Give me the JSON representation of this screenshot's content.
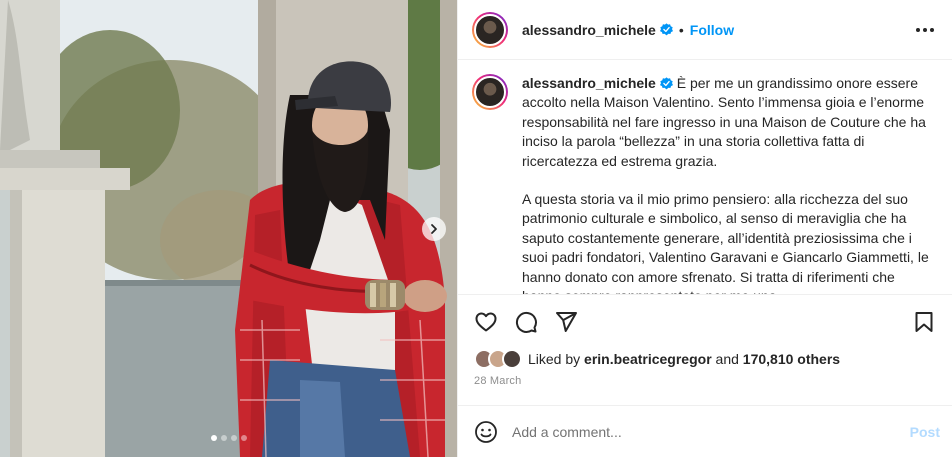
{
  "post": {
    "username": "alessandro_michele",
    "verified": true,
    "follow_label": "Follow",
    "separator": "•",
    "caption_paragraphs": [
      "È per me un grandissimo onore essere accolto nella Maison Valentino. Sento l’immensa gioia e l’enorme responsabilità nel fare ingresso in una Maison de Couture che ha inciso la parola “bellezza” in una storia collettiva fatta di ricercatezza ed estrema grazia.",
      "A questa storia va il mio primo pensiero: alla ricchezza del suo patrimonio culturale e simbolico, al senso di meraviglia che ha saputo costantemente generare, all’identità preziosissima che i suoi padri fondatori, Valentino Garavani e Giancarlo Giammetti, le hanno donato con amore sfrenato. Si tratta di riferimenti che hanno sempre rappresentato per me una"
    ],
    "carousel": {
      "total": 4,
      "current": 1
    }
  },
  "likes": {
    "prefix": "Liked by",
    "liker": "erin.beatricegregor",
    "middle": "and",
    "others": "170,810 others"
  },
  "date": "28 March",
  "comment_box": {
    "placeholder": "Add a comment...",
    "post_label": "Post"
  },
  "colors": {
    "accent": "#0095f6",
    "post_disabled": "#b3dbff",
    "muted": "#8e8e8e"
  },
  "icons": [
    "next-arrow-icon",
    "verified-badge-icon",
    "more-options-icon",
    "heart-icon",
    "comment-icon",
    "share-icon",
    "bookmark-icon",
    "emoji-icon"
  ]
}
